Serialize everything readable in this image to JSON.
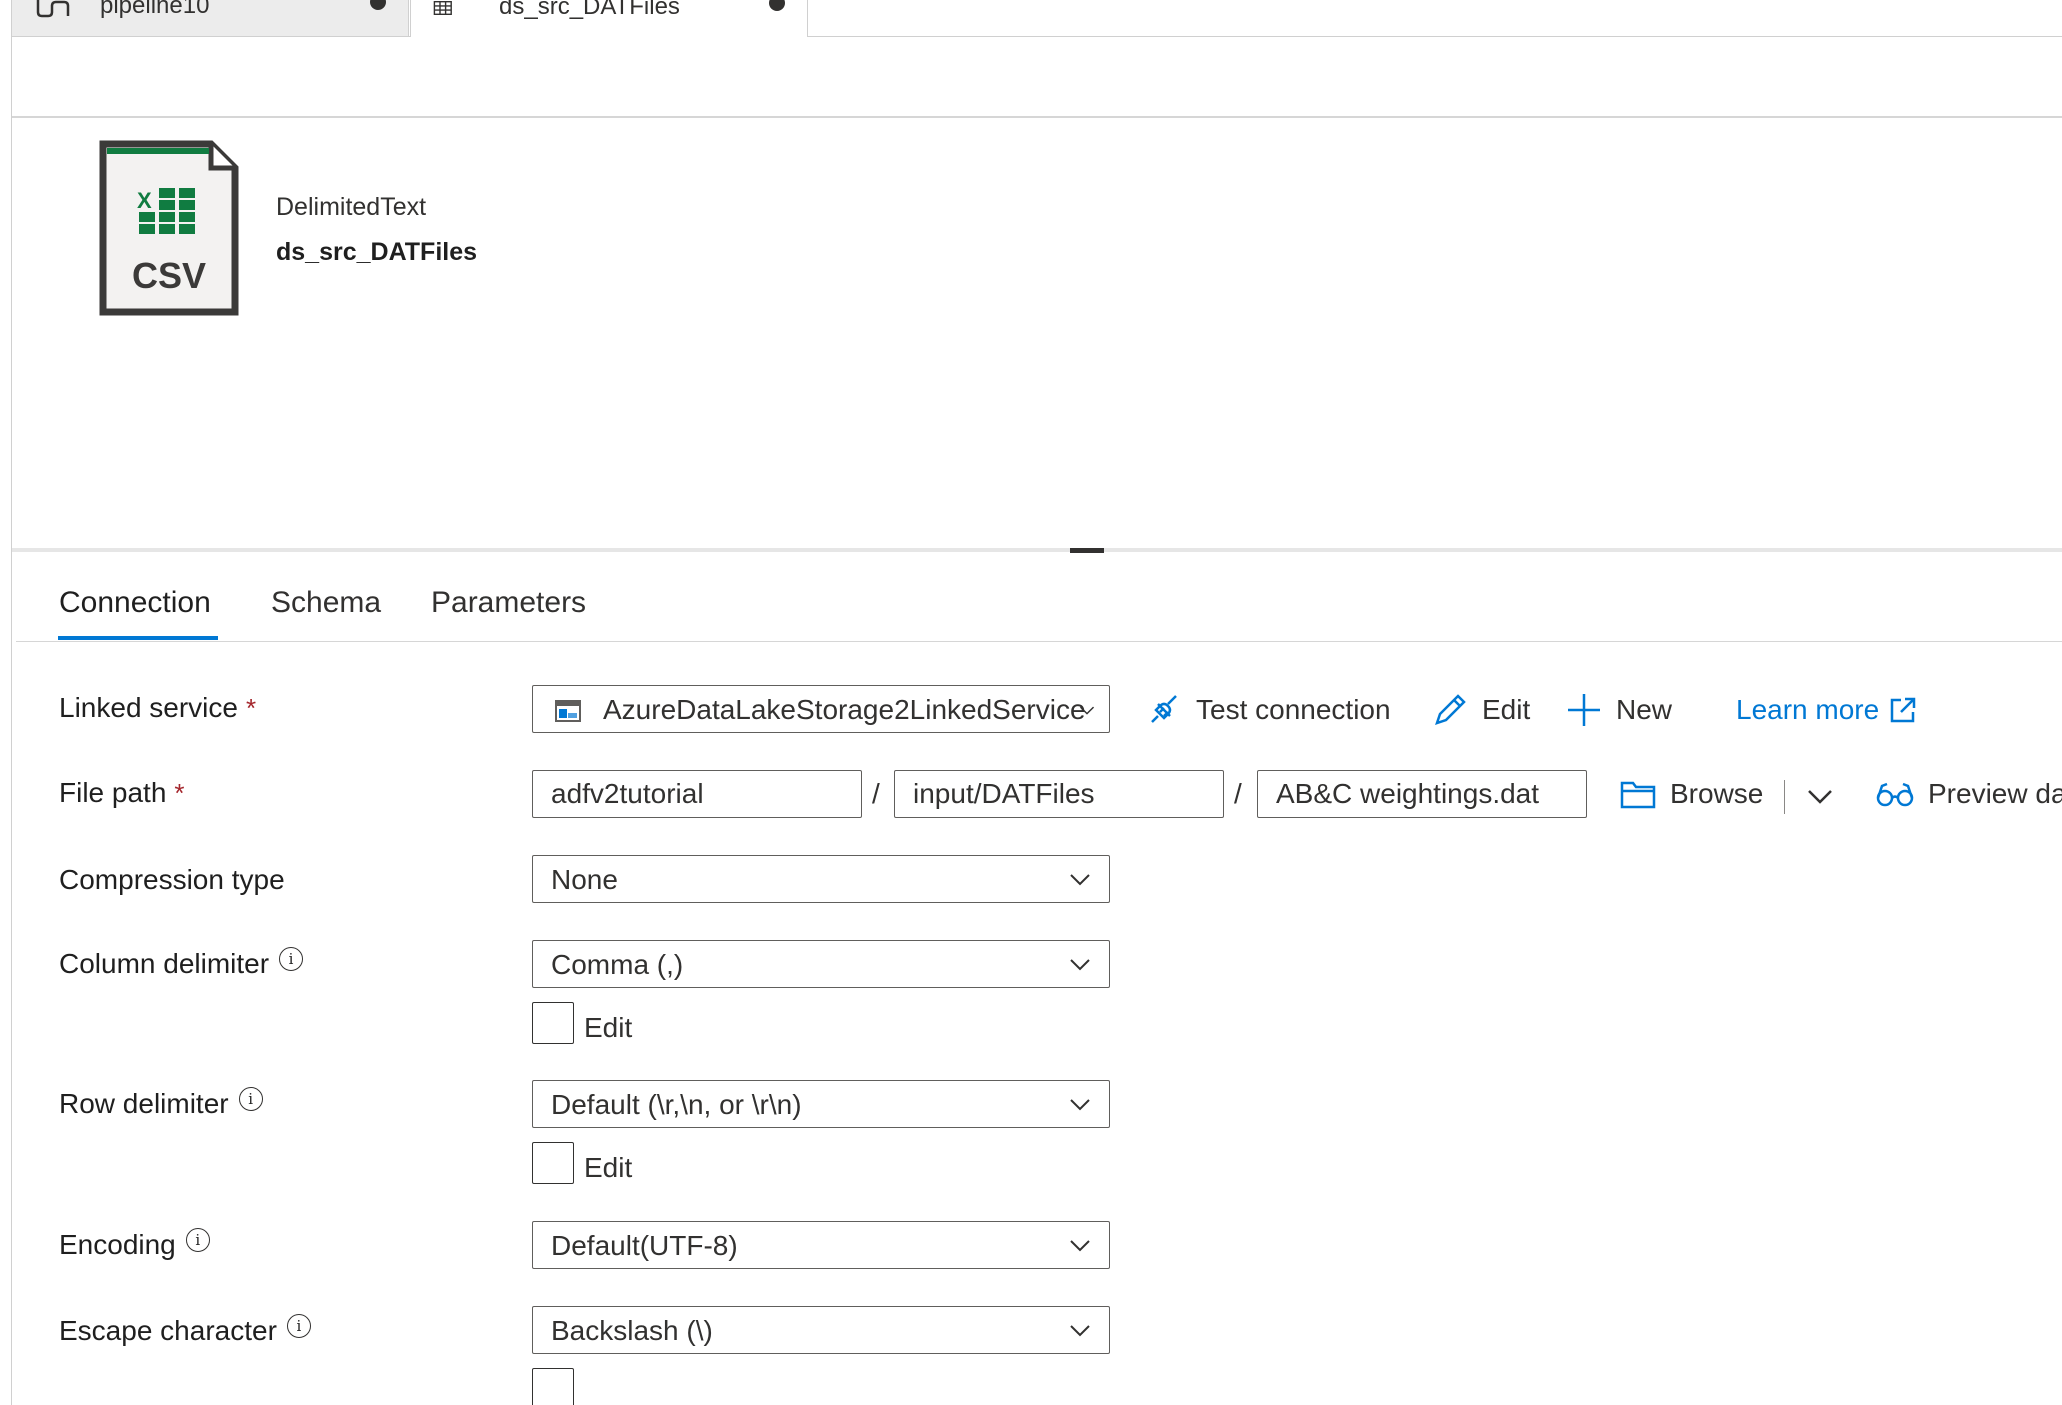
{
  "tabs": [
    {
      "label": "pipeline10",
      "icon": "pipeline-icon"
    },
    {
      "label": "ds_src_DATFiles",
      "icon": "table-icon"
    }
  ],
  "header": {
    "icon_label": "CSV",
    "dataset_type": "DelimitedText",
    "dataset_name": "ds_src_DATFiles"
  },
  "property_tabs": [
    "Connection",
    "Schema",
    "Parameters"
  ],
  "form": {
    "linked_service": {
      "label": "Linked service",
      "required": "*",
      "value": "AzureDataLakeStorage2LinkedService",
      "actions": {
        "test_connection": "Test connection",
        "edit": "Edit",
        "new": "New",
        "learn_more": "Learn more"
      }
    },
    "file_path": {
      "label": "File path",
      "required": "*",
      "container": "adfv2tutorial",
      "directory": "input/DATFiles",
      "file": "AB&C weightings.dat",
      "separator": "/",
      "browse": "Browse",
      "preview": "Preview data"
    },
    "compression_type": {
      "label": "Compression type",
      "value": "None"
    },
    "column_delimiter": {
      "label": "Column delimiter",
      "value": "Comma (,)",
      "edit_label": "Edit"
    },
    "row_delimiter": {
      "label": "Row delimiter",
      "value": "Default (\\r,\\n, or \\r\\n)",
      "edit_label": "Edit"
    },
    "encoding": {
      "label": "Encoding",
      "value": "Default(UTF-8)"
    },
    "escape_character": {
      "label": "Escape character",
      "value": "Backslash (\\)"
    }
  },
  "colors": {
    "accent": "#0078d4",
    "required": "#a4262c",
    "excel_green": "#107c41"
  }
}
